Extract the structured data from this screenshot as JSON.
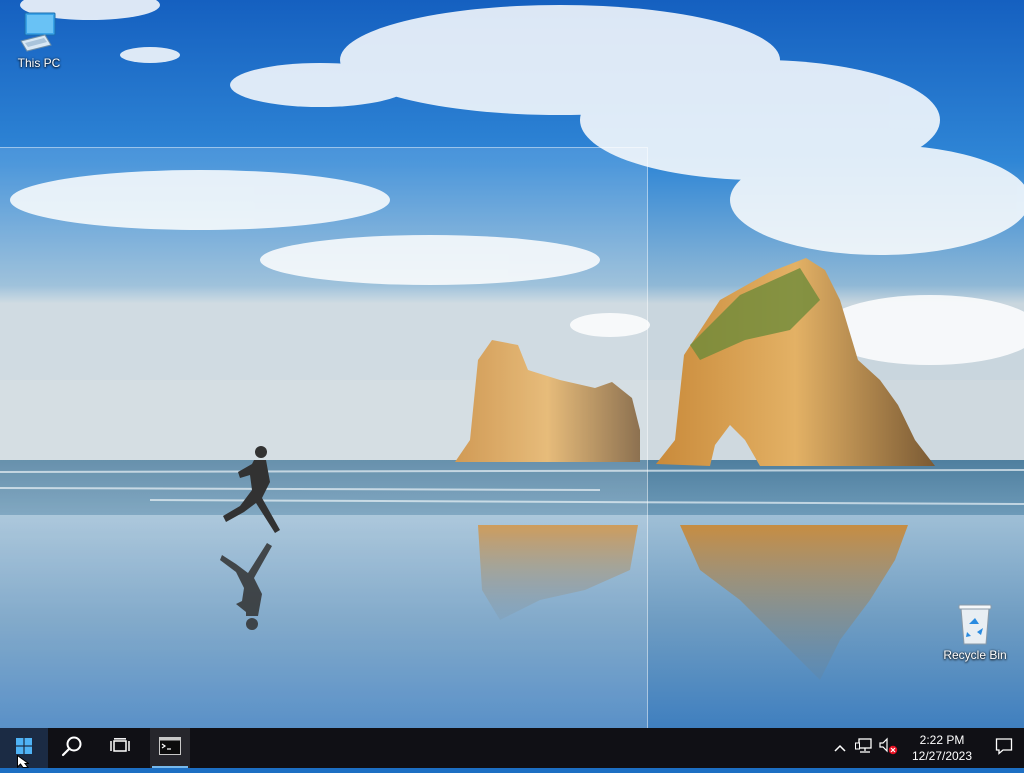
{
  "desktop": {
    "icons": [
      {
        "label": "This PC",
        "icon": "computer-icon"
      },
      {
        "label": "Recycle Bin",
        "icon": "recycle-bin-icon"
      }
    ]
  },
  "taskbar": {
    "start_icon": "windows-logo-icon",
    "search_icon": "search-icon",
    "task_view_icon": "task-view-icon",
    "apps": [
      {
        "name": "Command Prompt",
        "icon": "command-prompt-icon",
        "active": true
      }
    ],
    "tray": {
      "icons": [
        "chevron-up-icon",
        "network-icon",
        "volume-muted-icon"
      ],
      "time": "2:22 PM",
      "date": "12/27/2023",
      "notification_icon": "action-center-icon"
    }
  },
  "colors": {
    "taskbar": "#101015",
    "accent": "#76b9ed",
    "sky": "#1d6fc3"
  }
}
